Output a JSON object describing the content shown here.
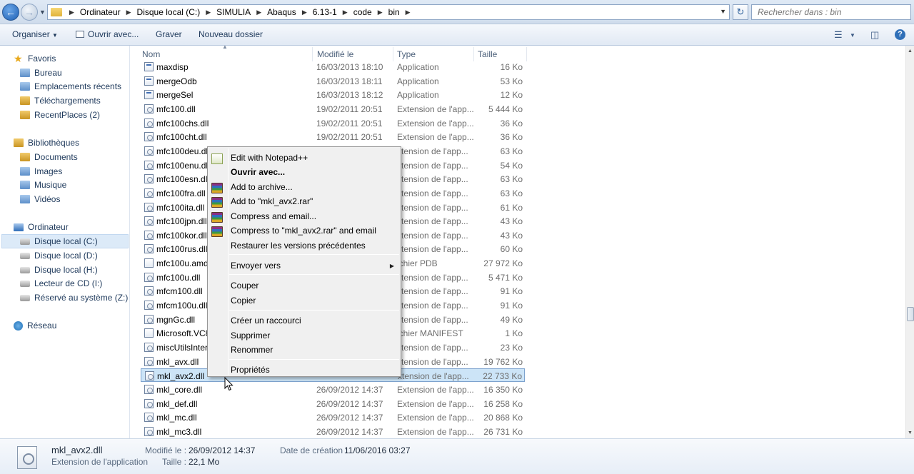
{
  "address": {
    "crumbs": [
      "Ordinateur",
      "Disque local (C:)",
      "SIMULIA",
      "Abaqus",
      "6.13-1",
      "code",
      "bin"
    ],
    "search_placeholder": "Rechercher dans : bin"
  },
  "toolbar": {
    "organize": "Organiser",
    "open_with": "Ouvrir avec...",
    "burn": "Graver",
    "new_folder": "Nouveau dossier"
  },
  "nav": {
    "favorites_title": "Favoris",
    "favorites": [
      "Bureau",
      "Emplacements récents",
      "Téléchargements",
      "RecentPlaces (2)"
    ],
    "libraries_title": "Bibliothèques",
    "libraries": [
      "Documents",
      "Images",
      "Musique",
      "Vidéos"
    ],
    "computer_title": "Ordinateur",
    "drives": [
      "Disque local (C:)",
      "Disque local (D:)",
      "Disque local (H:)",
      "Lecteur de CD (I:)",
      "Réservé au système (Z:)"
    ],
    "network": "Réseau"
  },
  "columns": {
    "name": "Nom",
    "modified": "Modifié le",
    "type": "Type",
    "size": "Taille"
  },
  "files": [
    {
      "name": "maxdisp",
      "date": "16/03/2013 18:10",
      "type": "Application",
      "size": "16 Ko",
      "icon": "app"
    },
    {
      "name": "mergeOdb",
      "date": "16/03/2013 18:11",
      "type": "Application",
      "size": "53 Ko",
      "icon": "app"
    },
    {
      "name": "mergeSel",
      "date": "16/03/2013 18:12",
      "type": "Application",
      "size": "12 Ko",
      "icon": "app"
    },
    {
      "name": "mfc100.dll",
      "date": "19/02/2011 20:51",
      "type": "Extension de l'app...",
      "size": "5 444 Ko",
      "icon": "dll"
    },
    {
      "name": "mfc100chs.dll",
      "date": "19/02/2011 20:51",
      "type": "Extension de l'app...",
      "size": "36 Ko",
      "icon": "dll"
    },
    {
      "name": "mfc100cht.dll",
      "date": "19/02/2011 20:51",
      "type": "Extension de l'app...",
      "size": "36 Ko",
      "icon": "dll"
    },
    {
      "name": "mfc100deu.dll",
      "date": "",
      "type": "xtension de l'app...",
      "size": "63 Ko",
      "icon": "dll"
    },
    {
      "name": "mfc100enu.dll",
      "date": "",
      "type": "xtension de l'app...",
      "size": "54 Ko",
      "icon": "dll"
    },
    {
      "name": "mfc100esn.dll",
      "date": "",
      "type": "xtension de l'app...",
      "size": "63 Ko",
      "icon": "dll"
    },
    {
      "name": "mfc100fra.dll",
      "date": "",
      "type": "xtension de l'app...",
      "size": "63 Ko",
      "icon": "dll"
    },
    {
      "name": "mfc100ita.dll",
      "date": "",
      "type": "xtension de l'app...",
      "size": "61 Ko",
      "icon": "dll"
    },
    {
      "name": "mfc100jpn.dll",
      "date": "",
      "type": "xtension de l'app...",
      "size": "43 Ko",
      "icon": "dll"
    },
    {
      "name": "mfc100kor.dll",
      "date": "",
      "type": "xtension de l'app...",
      "size": "43 Ko",
      "icon": "dll"
    },
    {
      "name": "mfc100rus.dll",
      "date": "",
      "type": "xtension de l'app...",
      "size": "60 Ko",
      "icon": "dll"
    },
    {
      "name": "mfc100u.amd6",
      "date": "",
      "type": "ichier PDB",
      "size": "27 972 Ko",
      "icon": "file"
    },
    {
      "name": "mfc100u.dll",
      "date": "",
      "type": "xtension de l'app...",
      "size": "5 471 Ko",
      "icon": "dll"
    },
    {
      "name": "mfcm100.dll",
      "date": "",
      "type": "xtension de l'app...",
      "size": "91 Ko",
      "icon": "dll"
    },
    {
      "name": "mfcm100u.dll",
      "date": "",
      "type": "xtension de l'app...",
      "size": "91 Ko",
      "icon": "dll"
    },
    {
      "name": "mgnGc.dll",
      "date": "",
      "type": "xtension de l'app...",
      "size": "49 Ko",
      "icon": "dll"
    },
    {
      "name": "Microsoft.VC8",
      "date": "",
      "type": "ichier MANIFEST",
      "size": "1 Ko",
      "icon": "file"
    },
    {
      "name": "miscUtilsIntern",
      "date": "",
      "type": "xtension de l'app...",
      "size": "23 Ko",
      "icon": "dll"
    },
    {
      "name": "mkl_avx.dll",
      "date": "",
      "type": "xtension de l'app...",
      "size": "19 762 Ko",
      "icon": "dll"
    },
    {
      "name": "mkl_avx2.dll",
      "date": "",
      "type": "xtension de l'app...",
      "size": "22 733 Ko",
      "icon": "dll",
      "selected": true
    },
    {
      "name": "mkl_core.dll",
      "date": "26/09/2012 14:37",
      "type": "Extension de l'app...",
      "size": "16 350 Ko",
      "icon": "dll"
    },
    {
      "name": "mkl_def.dll",
      "date": "26/09/2012 14:37",
      "type": "Extension de l'app...",
      "size": "16 258 Ko",
      "icon": "dll"
    },
    {
      "name": "mkl_mc.dll",
      "date": "26/09/2012 14:37",
      "type": "Extension de l'app...",
      "size": "20 868 Ko",
      "icon": "dll"
    },
    {
      "name": "mkl_mc3.dll",
      "date": "26/09/2012 14:37",
      "type": "Extension de l'app...",
      "size": "26 731 Ko",
      "icon": "dll"
    }
  ],
  "context_menu": {
    "items": [
      {
        "label": "Edit with Notepad++",
        "icon": "notepad-plus-plus-icon"
      },
      {
        "label": "Ouvrir avec...",
        "bold": true
      },
      {
        "label": "Add to archive...",
        "icon": "winrar-icon"
      },
      {
        "label": "Add to \"mkl_avx2.rar\"",
        "icon": "winrar-icon"
      },
      {
        "label": "Compress and email...",
        "icon": "winrar-icon"
      },
      {
        "label": "Compress to \"mkl_avx2.rar\" and email",
        "icon": "winrar-icon"
      },
      {
        "label": "Restaurer les versions précédentes"
      },
      {
        "label": "Envoyer vers",
        "submenu": true
      },
      {
        "label": "Couper"
      },
      {
        "label": "Copier"
      },
      {
        "label": "Créer un raccourci"
      },
      {
        "label": "Supprimer"
      },
      {
        "label": "Renommer"
      },
      {
        "label": "Propriétés"
      }
    ]
  },
  "details": {
    "filename": "mkl_avx2.dll",
    "filetype": "Extension de l'application",
    "modified_label": "Modifié le :",
    "modified_value": "26/09/2012 14:37",
    "size_label": "Taille :",
    "size_value": "22,1 Mo",
    "created_label": "Date de création :",
    "created_value": "11/06/2016 03:27"
  },
  "colors": {
    "selection": "#cce4f7",
    "selection_border": "#7da2ce",
    "accent": "#1e395b"
  }
}
